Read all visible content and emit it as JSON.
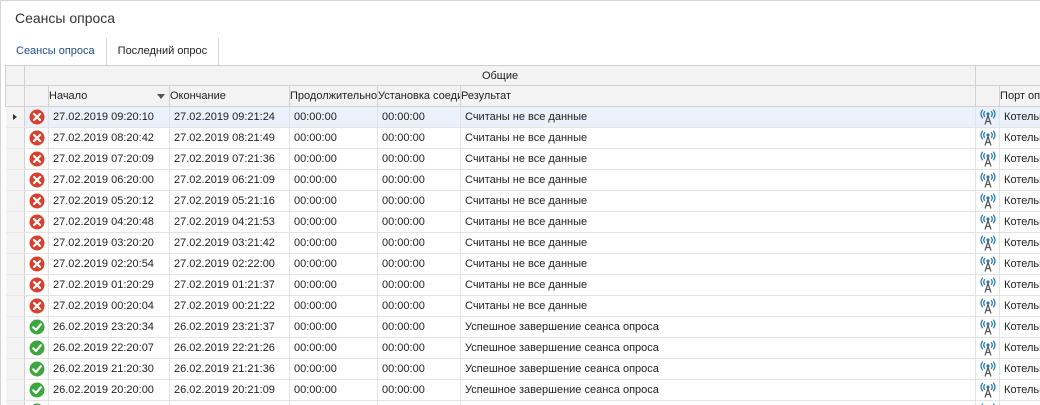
{
  "window": {
    "title": "Сеансы опроса"
  },
  "tabs": [
    {
      "label": "Сеансы опроса",
      "active": true
    },
    {
      "label": "Последний опрос",
      "active": false
    }
  ],
  "grid": {
    "band_label": "Общие",
    "columns": {
      "start": "Начало",
      "end": "Окончание",
      "duration": "Продолжительность",
      "setup": "Установка соединения",
      "result": "Результат",
      "port": "Порт опроса"
    },
    "sort": {
      "column": "start",
      "direction": "descending"
    },
    "colors": {
      "error": "#d9412f",
      "success": "#3ea63e",
      "focus_row": "#eaf1fb",
      "port_icon": "#2a7ab5"
    },
    "rows": [
      {
        "status": "error",
        "start": "27.02.2019 09:20:10",
        "end": "27.02.2019 09:21:24",
        "duration": "00:00:00",
        "setup": "00:00:00",
        "result": "Считаны не все данные",
        "port": "Котельная"
      },
      {
        "status": "error",
        "start": "27.02.2019 08:20:42",
        "end": "27.02.2019 08:21:49",
        "duration": "00:00:00",
        "setup": "00:00:00",
        "result": "Считаны не все данные",
        "port": "Котельная"
      },
      {
        "status": "error",
        "start": "27.02.2019 07:20:09",
        "end": "27.02.2019 07:21:36",
        "duration": "00:00:00",
        "setup": "00:00:00",
        "result": "Считаны не все данные",
        "port": "Котельная"
      },
      {
        "status": "error",
        "start": "27.02.2019 06:20:00",
        "end": "27.02.2019 06:21:09",
        "duration": "00:00:00",
        "setup": "00:00:00",
        "result": "Считаны не все данные",
        "port": "Котельная"
      },
      {
        "status": "error",
        "start": "27.02.2019 05:20:12",
        "end": "27.02.2019 05:21:16",
        "duration": "00:00:00",
        "setup": "00:00:00",
        "result": "Считаны не все данные",
        "port": "Котельная"
      },
      {
        "status": "error",
        "start": "27.02.2019 04:20:48",
        "end": "27.02.2019 04:21:53",
        "duration": "00:00:00",
        "setup": "00:00:00",
        "result": "Считаны не все данные",
        "port": "Котельная"
      },
      {
        "status": "error",
        "start": "27.02.2019 03:20:20",
        "end": "27.02.2019 03:21:42",
        "duration": "00:00:00",
        "setup": "00:00:00",
        "result": "Считаны не все данные",
        "port": "Котельная"
      },
      {
        "status": "error",
        "start": "27.02.2019 02:20:54",
        "end": "27.02.2019 02:22:00",
        "duration": "00:00:00",
        "setup": "00:00:00",
        "result": "Считаны не все данные",
        "port": "Котельная"
      },
      {
        "status": "error",
        "start": "27.02.2019 01:20:29",
        "end": "27.02.2019 01:21:37",
        "duration": "00:00:00",
        "setup": "00:00:00",
        "result": "Считаны не все данные",
        "port": "Котельная"
      },
      {
        "status": "error",
        "start": "27.02.2019 00:20:04",
        "end": "27.02.2019 00:21:22",
        "duration": "00:00:00",
        "setup": "00:00:00",
        "result": "Считаны не все данные",
        "port": "Котельная"
      },
      {
        "status": "success",
        "start": "26.02.2019 23:20:34",
        "end": "26.02.2019 23:21:37",
        "duration": "00:00:00",
        "setup": "00:00:00",
        "result": "Успешное завершение сеанса опроса",
        "port": "Котельная"
      },
      {
        "status": "success",
        "start": "26.02.2019 22:20:07",
        "end": "26.02.2019 22:21:26",
        "duration": "00:00:00",
        "setup": "00:00:00",
        "result": "Успешное завершение сеанса опроса",
        "port": "Котельная"
      },
      {
        "status": "success",
        "start": "26.02.2019 21:20:30",
        "end": "26.02.2019 21:21:36",
        "duration": "00:00:00",
        "setup": "00:00:00",
        "result": "Успешное завершение сеанса опроса",
        "port": "Котельная"
      },
      {
        "status": "success",
        "start": "26.02.2019 20:20:00",
        "end": "26.02.2019 20:21:09",
        "duration": "00:00:00",
        "setup": "00:00:00",
        "result": "Успешное завершение сеанса опроса",
        "port": "Котельная"
      },
      {
        "status": "success",
        "start": "",
        "end": "",
        "duration": "",
        "setup": "",
        "result": "",
        "port": ""
      }
    ]
  }
}
